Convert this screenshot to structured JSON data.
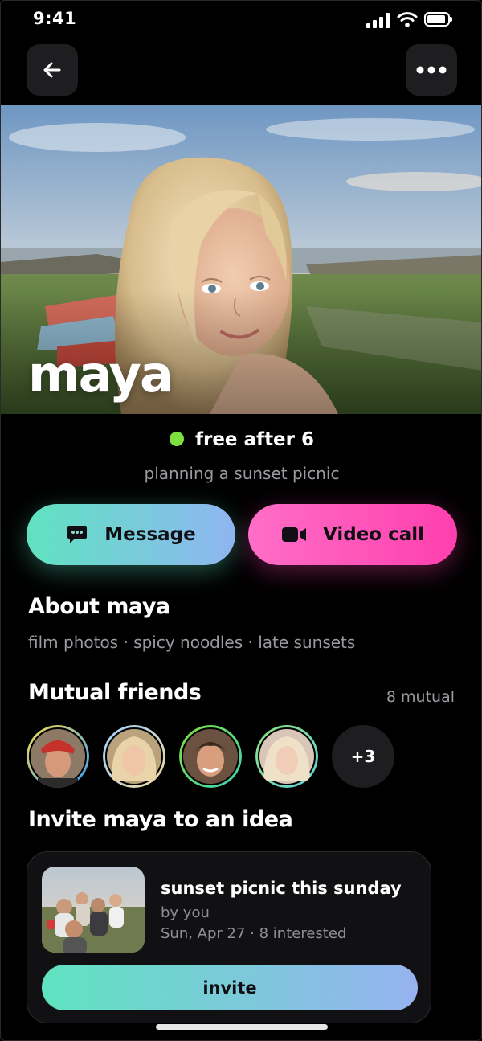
{
  "status_bar": {
    "time": "9:41"
  },
  "profile": {
    "name": "maya",
    "availability": "free after 6",
    "activity": "planning a sunset picnic"
  },
  "actions": {
    "message_label": "Message",
    "video_label": "Video call"
  },
  "about": {
    "title": "About maya",
    "text": "film photos · spicy noodles · late sunsets"
  },
  "mutual": {
    "title": "Mutual friends",
    "count_label": "8 mutual",
    "more_label": "+3"
  },
  "invite_section": {
    "title": "Invite maya to an idea",
    "card": {
      "title": "sunset picnic this sunday",
      "by": "by you",
      "meta": "Sun, Apr 27 · 8 interested",
      "button_label": "invite"
    }
  },
  "colors": {
    "available_dot": "#7ee040",
    "message_gradient": [
      "#5fe3c0",
      "#8fb6f2"
    ],
    "video_gradient": [
      "#ff6ec7",
      "#ff3fae"
    ]
  }
}
